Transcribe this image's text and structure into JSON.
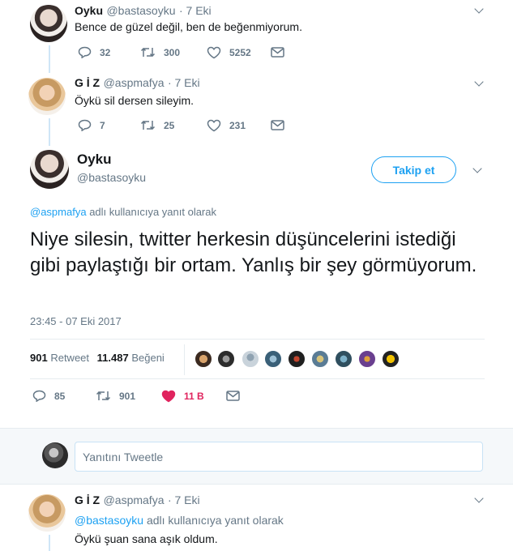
{
  "tweets": [
    {
      "name": "Oyku",
      "handle": "@bastasoyku",
      "time": "· 7 Eki",
      "text": "Bence de güzel değil, ben de beğenmiyorum.",
      "replies": "32",
      "retweets": "300",
      "likes": "5252"
    },
    {
      "name": "G İ Z",
      "handle": "@aspmafya",
      "time": "· 7 Eki",
      "text": "Öykü sil dersen sileyim.",
      "replies": "7",
      "retweets": "25",
      "likes": "231"
    }
  ],
  "focused": {
    "name": "Oyku",
    "handle": "@bastasoyku",
    "follow_label": "Takip et",
    "reply_to_mention": "@aspmafya",
    "reply_to_suffix": "adlı kullanıcıya yanıt olarak",
    "text": "Niye silesin, twitter herkesin düşüncelerini istediği gibi paylaştığı bir ortam. Yanlış bir şey görmüyorum.",
    "timestamp": "23:45 - 07 Eki 2017",
    "retweet_count": "901",
    "retweet_label": "Retweet",
    "like_count": "11.487",
    "like_label": "Beğeni",
    "actions": {
      "replies": "85",
      "retweets": "901",
      "likes": "11 B"
    }
  },
  "compose": {
    "placeholder": "Yanıtını Tweetle"
  },
  "reply_tweet": {
    "name": "G İ Z",
    "handle": "@aspmafya",
    "time": "· 7 Eki",
    "reply_to_mention": "@bastasoyku",
    "reply_to_suffix": "adlı kullanıcıya yanıt olarak",
    "text": "Öykü şuan sana aşık oldum."
  },
  "colors": {
    "accent": "#1da1f2",
    "like_active": "#e0245e",
    "muted": "#657786"
  }
}
